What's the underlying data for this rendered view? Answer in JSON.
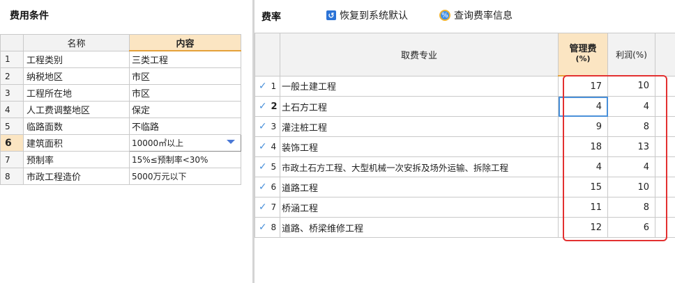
{
  "left": {
    "title": "费用条件",
    "headers": {
      "name": "名称",
      "content": "内容"
    },
    "rows": [
      {
        "idx": "1",
        "name": "工程类别",
        "value": "三类工程"
      },
      {
        "idx": "2",
        "name": "纳税地区",
        "value": "市区"
      },
      {
        "idx": "3",
        "name": "工程所在地",
        "value": "市区"
      },
      {
        "idx": "4",
        "name": "人工费调整地区",
        "value": "保定"
      },
      {
        "idx": "5",
        "name": "临路面数",
        "value": "不临路"
      },
      {
        "idx": "6",
        "name": "建筑面积",
        "value": "10000㎡以上"
      },
      {
        "idx": "7",
        "name": "预制率",
        "value": "15%≤预制率<30%"
      },
      {
        "idx": "8",
        "name": "市政工程造价",
        "value": "5000万元以下"
      }
    ]
  },
  "right": {
    "title": "费率",
    "restore_label": "恢复到系统默认",
    "query_label": "查询费率信息",
    "headers": {
      "spec": "取费专业",
      "mgmt_line1": "管理费",
      "mgmt_line2": "(%)",
      "profit": "利润(%)"
    },
    "rows": [
      {
        "num": "1",
        "spec": "一般土建工程",
        "mgmt": "17",
        "profit": "10"
      },
      {
        "num": "2",
        "spec": "土石方工程",
        "mgmt": "4",
        "profit": "4"
      },
      {
        "num": "3",
        "spec": "灌注桩工程",
        "mgmt": "9",
        "profit": "8"
      },
      {
        "num": "4",
        "spec": "装饰工程",
        "mgmt": "18",
        "profit": "13"
      },
      {
        "num": "5",
        "spec": "市政土石方工程、大型机械一次安拆及场外运输、拆除工程",
        "mgmt": "4",
        "profit": "4"
      },
      {
        "num": "6",
        "spec": "道路工程",
        "mgmt": "15",
        "profit": "10"
      },
      {
        "num": "7",
        "spec": "桥涵工程",
        "mgmt": "11",
        "profit": "8"
      },
      {
        "num": "8",
        "spec": "道路、桥梁维修工程",
        "mgmt": "12",
        "profit": "6"
      }
    ],
    "check_glyph": "✓",
    "highlight_color": "#e33030"
  }
}
